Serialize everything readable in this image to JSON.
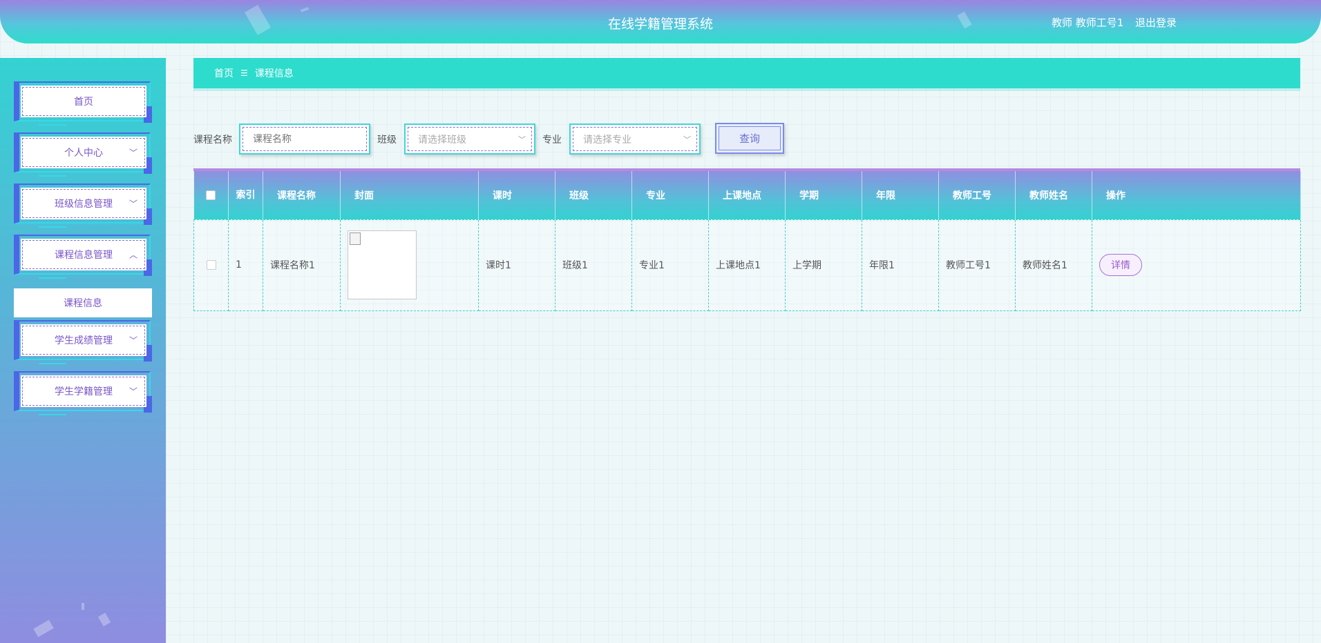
{
  "header": {
    "title": "在线学籍管理系统",
    "user": "教师 教师工号1",
    "logout": "退出登录"
  },
  "sidebar": {
    "items": [
      {
        "label": "首页",
        "chevron": ""
      },
      {
        "label": "个人中心",
        "chevron": "﹀"
      },
      {
        "label": "班级信息管理",
        "chevron": "﹀"
      },
      {
        "label": "课程信息管理",
        "chevron": "︿"
      },
      {
        "label": "学生成绩管理",
        "chevron": "﹀"
      },
      {
        "label": "学生学籍管理",
        "chevron": "﹀"
      }
    ],
    "submenu": {
      "label": "课程信息"
    }
  },
  "breadcrumb": {
    "home": "首页",
    "separator": "☰",
    "current": "课程信息"
  },
  "search": {
    "course_name_label": "课程名称",
    "course_name_placeholder": "课程名称",
    "class_label": "班级",
    "class_placeholder": "请选择班级",
    "major_label": "专业",
    "major_placeholder": "请选择专业",
    "query_button": "查询"
  },
  "table": {
    "headers": {
      "index": "索引",
      "course_name": "课程名称",
      "cover": "封面",
      "hours": "课时",
      "class": "班级",
      "major": "专业",
      "location": "上课地点",
      "semester": "学期",
      "duration": "年限",
      "teacher_id": "教师工号",
      "teacher_name": "教师姓名",
      "actions": "操作"
    },
    "rows": [
      {
        "index": "1",
        "course_name": "课程名称1",
        "hours": "课时1",
        "class": "班级1",
        "major": "专业1",
        "location": "上课地点1",
        "semester": "上学期",
        "duration": "年限1",
        "teacher_id": "教师工号1",
        "teacher_name": "教师姓名1",
        "detail_button": "详情"
      }
    ]
  },
  "colors": {
    "accent_teal": "#2ddccd",
    "accent_purple": "#9a5bd0",
    "menu_border_blue": "#4b67e6"
  }
}
